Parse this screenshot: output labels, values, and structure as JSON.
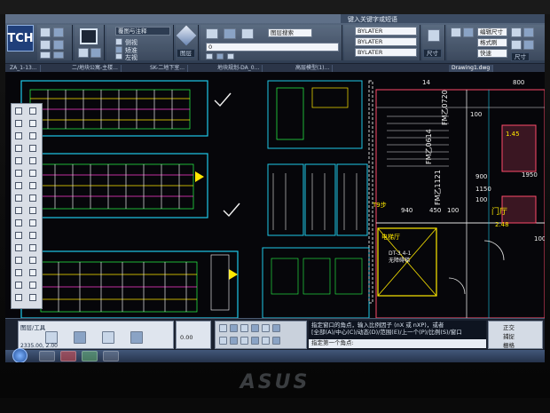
{
  "window": {
    "title_right": "键入关键字或短语"
  },
  "ribbon": {
    "logo": "TCH",
    "group1_labels": [
      "侧视",
      "矫准",
      "左视"
    ],
    "view_combo": "覆图与注释",
    "layer_combos": [
      "BYLATER",
      "BYLATER",
      "BYLATER"
    ],
    "search_box": "图层搜索",
    "layer_name": "0",
    "right_buttons": [
      "编辑尺寸",
      "格式刷",
      "快速",
      "尺寸"
    ],
    "tab_labels": [
      "图层",
      "尺寸"
    ]
  },
  "doctabs": [
    {
      "label": "ZA_1-13...",
      "active": false
    },
    {
      "label": "二/地块公寓-主楼...",
      "active": false
    },
    {
      "label": "SK-二地下室...",
      "active": false
    },
    {
      "label": "地块规划-DA_0...",
      "active": false
    },
    {
      "label": "高层模型(1)...",
      "active": false
    },
    {
      "label": "Drawing1.dwg",
      "active": true
    }
  ],
  "drawing": {
    "annotations": [
      "14",
      "800",
      "100",
      "1.45",
      "T9步",
      "电梯厅",
      "门厅",
      "940",
      "450",
      "100",
      "2.48",
      "1150",
      "900",
      "1950",
      "100",
      "DT-3.4-1",
      "无障碍梯",
      "FM乙0614",
      "FM乙0720",
      "FM乙1121",
      "100"
    ]
  },
  "command": {
    "left_tab": "图层/工具",
    "coords": "2335.00, 2.00",
    "value": "0.00",
    "line1": "指定窗口的角点，输入比例因子 (nX 或 nXP)，或者",
    "line2": "[全部(A)/中心(C)/动态(D)/范围(E)/上一个(P)/比例(S)/窗口",
    "prompt": "指定第一个角点:",
    "right_labels": [
      "正交",
      "捕捉",
      "栅格"
    ]
  },
  "taskbar": {
    "time": "",
    "colors": {
      "accent": "#2f3d52",
      "cad_cyan": "#00e5ff",
      "cad_yellow": "#ffe800",
      "cad_green": "#2aff4a"
    }
  }
}
